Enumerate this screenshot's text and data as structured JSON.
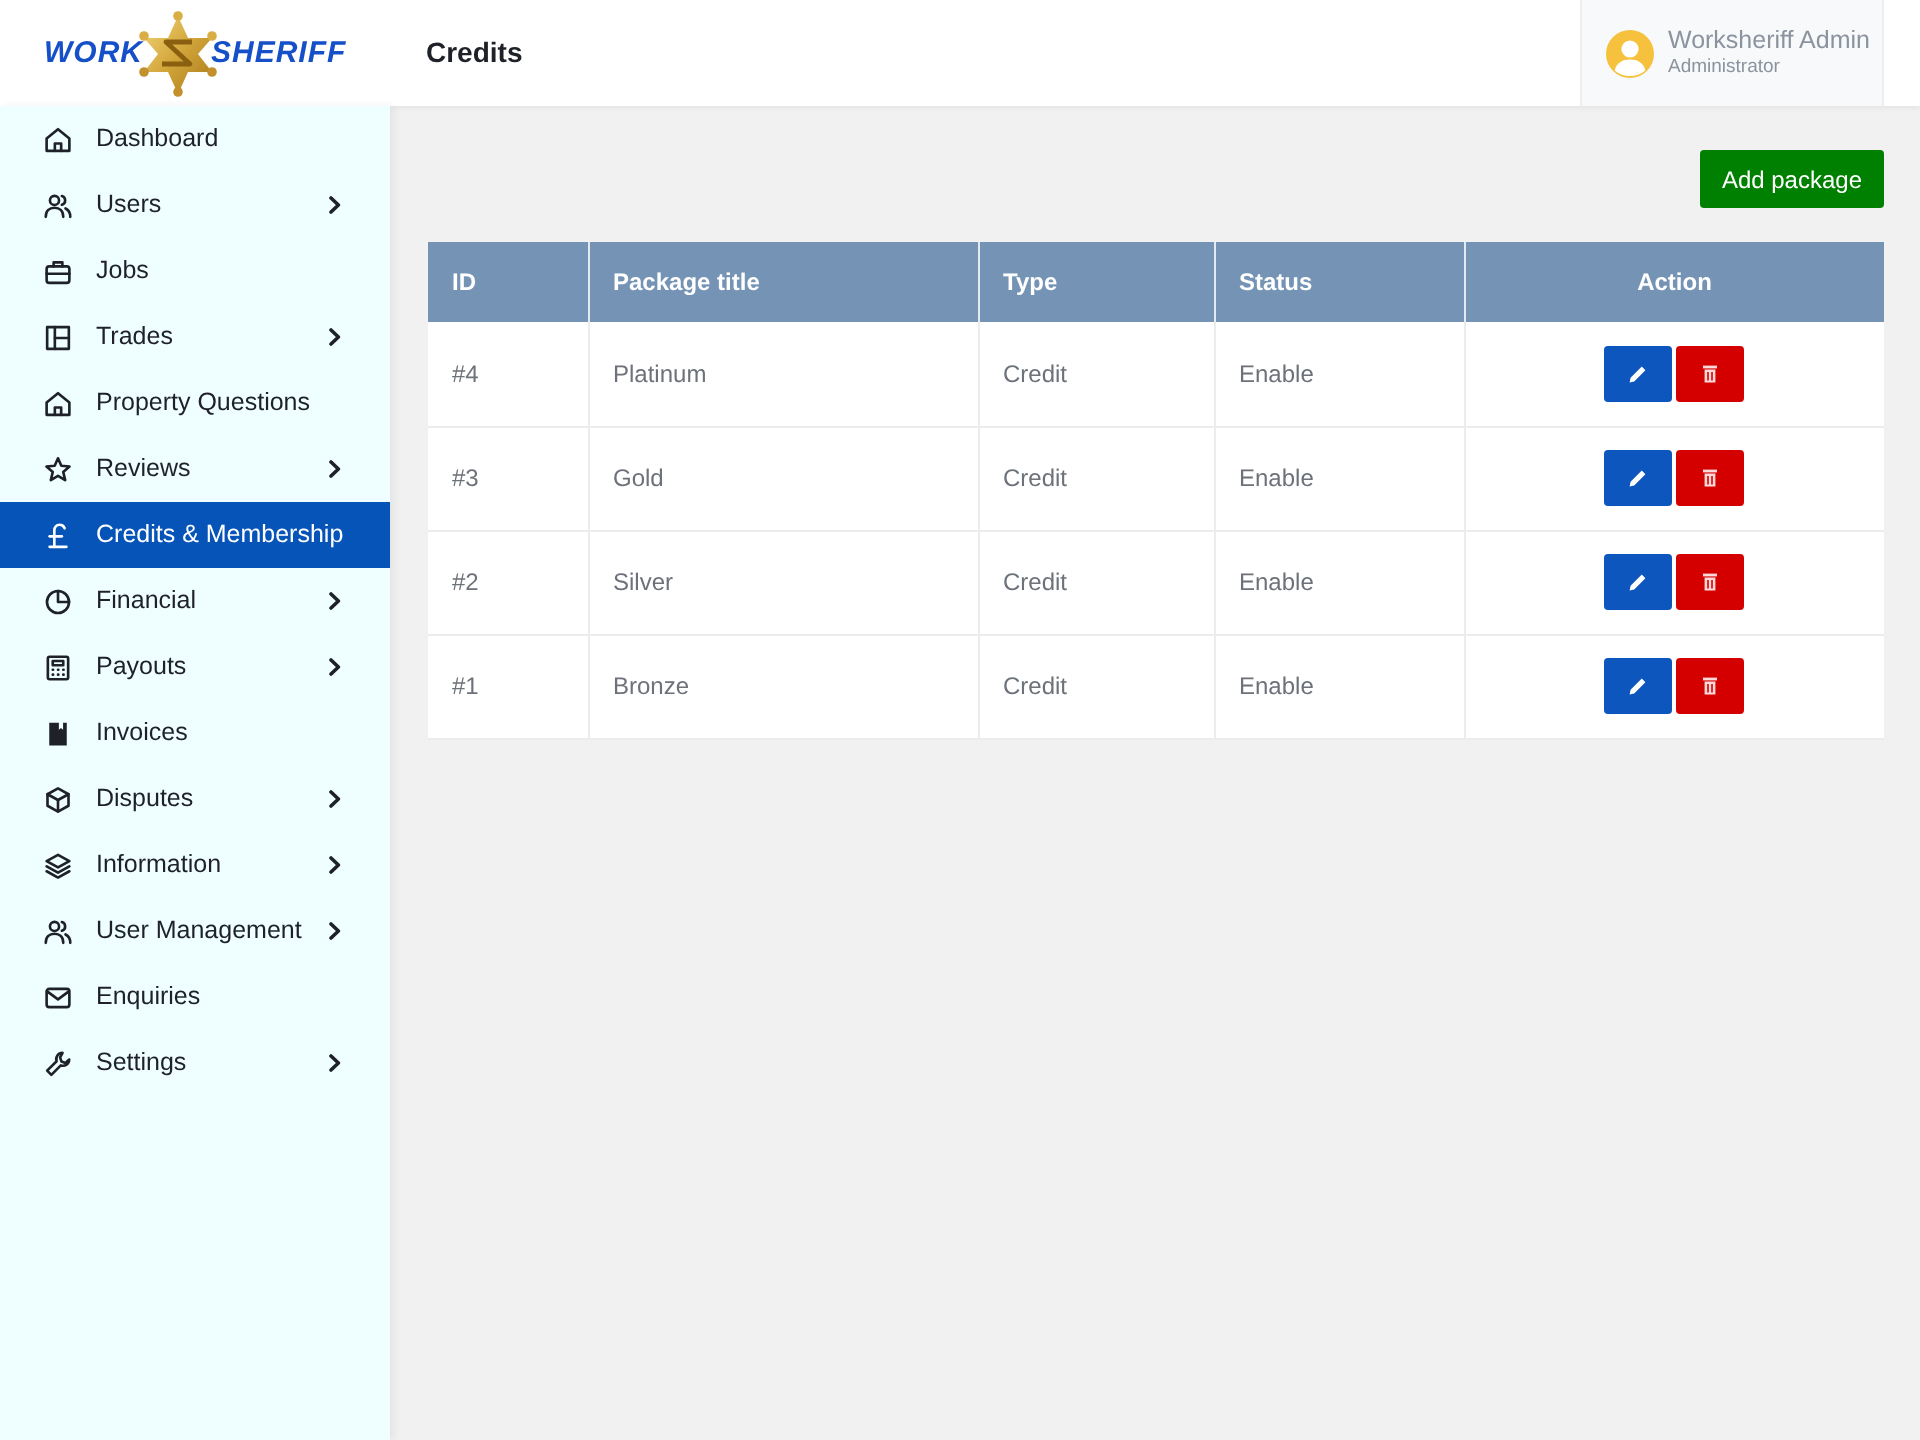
{
  "logo": {
    "left_word": "WORK",
    "right_word": "SHERIFF"
  },
  "sidebar": {
    "items": [
      {
        "label": "Dashboard",
        "has_submenu": false,
        "selected": false
      },
      {
        "label": "Users",
        "has_submenu": true,
        "selected": false
      },
      {
        "label": "Jobs",
        "has_submenu": false,
        "selected": false
      },
      {
        "label": "Trades",
        "has_submenu": true,
        "selected": false
      },
      {
        "label": "Property Questions",
        "has_submenu": false,
        "selected": false
      },
      {
        "label": "Reviews",
        "has_submenu": true,
        "selected": false
      },
      {
        "label": "Credits & Membership",
        "has_submenu": false,
        "selected": true
      },
      {
        "label": "Financial",
        "has_submenu": true,
        "selected": false
      },
      {
        "label": "Payouts",
        "has_submenu": true,
        "selected": false
      },
      {
        "label": "Invoices",
        "has_submenu": false,
        "selected": false
      },
      {
        "label": "Disputes",
        "has_submenu": true,
        "selected": false
      },
      {
        "label": "Information",
        "has_submenu": true,
        "selected": false
      },
      {
        "label": "User Management",
        "has_submenu": true,
        "selected": false
      },
      {
        "label": "Enquiries",
        "has_submenu": false,
        "selected": false
      },
      {
        "label": "Settings",
        "has_submenu": true,
        "selected": false
      }
    ]
  },
  "header": {
    "title": "Credits",
    "user": {
      "name": "Worksheriff Admin",
      "role": "Administrator"
    }
  },
  "toolbar": {
    "add_button": "Add package"
  },
  "table": {
    "columns": [
      "ID",
      "Package title",
      "Type",
      "Status",
      "Action"
    ],
    "rows": [
      {
        "id": "#4",
        "title": "Platinum",
        "type": "Credit",
        "status": "Enable"
      },
      {
        "id": "#3",
        "title": "Gold",
        "type": "Credit",
        "status": "Enable"
      },
      {
        "id": "#2",
        "title": "Silver",
        "type": "Credit",
        "status": "Enable"
      },
      {
        "id": "#1",
        "title": "Bronze",
        "type": "Credit",
        "status": "Enable"
      }
    ]
  }
}
